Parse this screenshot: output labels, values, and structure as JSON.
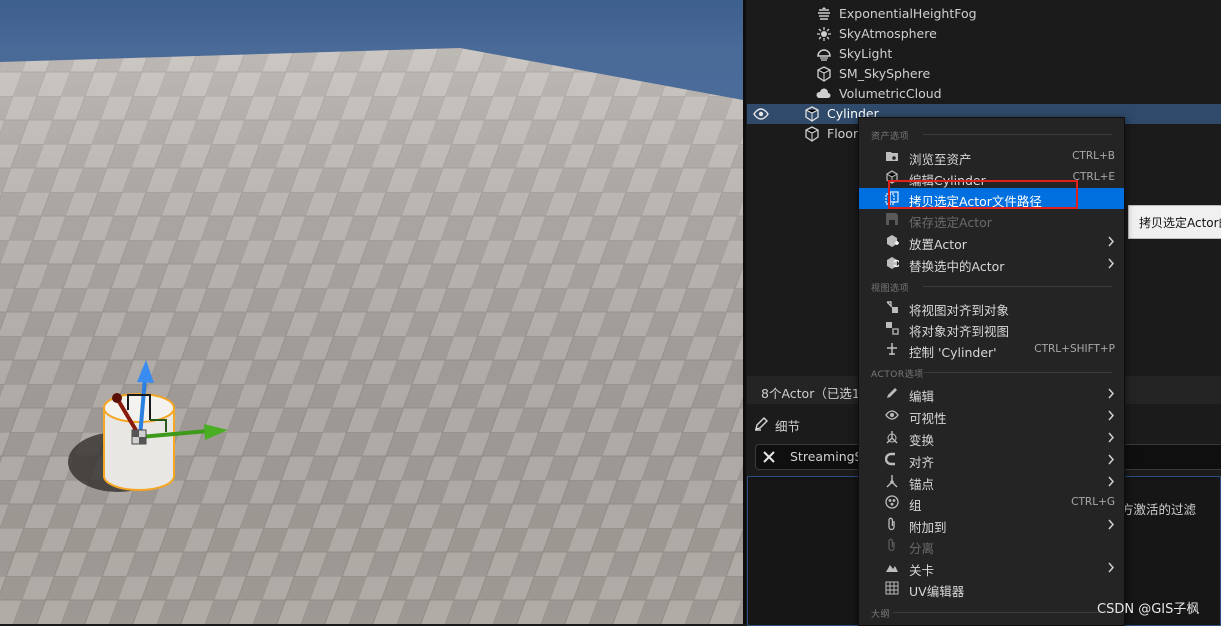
{
  "outliner": {
    "items": [
      {
        "label": "ExponentialHeightFog",
        "icon": "fog-icon"
      },
      {
        "label": "SkyAtmosphere",
        "icon": "sky-atmosphere-icon"
      },
      {
        "label": "SkyLight",
        "icon": "skylight-icon"
      },
      {
        "label": "SM_SkySphere",
        "icon": "static-mesh-icon"
      },
      {
        "label": "VolumetricCloud",
        "icon": "cloud-icon"
      },
      {
        "label": "Cylinder",
        "icon": "static-mesh-icon",
        "selected": true
      },
      {
        "label": "Floor",
        "icon": "static-mesh-icon"
      }
    ],
    "status": "8个Actor（已选1"
  },
  "details": {
    "title": "细节",
    "search_value": "StreamingSo",
    "hint_fragment": "更上方激活的过滤"
  },
  "tooltip": {
    "text": "拷贝选定Actor的"
  },
  "context_menu": {
    "sections": {
      "asset": "资产选项",
      "view": "视图选项",
      "actor": "ACTOR选项",
      "outline": "大纲"
    },
    "asset_items": [
      {
        "label": "浏览至资产",
        "shortcut": "CTRL+B",
        "icon": "browse-asset-icon"
      },
      {
        "label": "编辑Cylinder",
        "shortcut": "CTRL+E",
        "icon": "edit-mesh-icon"
      },
      {
        "label": "拷贝选定Actor文件路径",
        "icon": "copy-path-icon",
        "highlight": true
      },
      {
        "label": "保存选定Actor",
        "icon": "save-icon",
        "disabled": true
      },
      {
        "label": "放置Actor",
        "icon": "place-actor-icon",
        "submenu": true
      },
      {
        "label": "替换选中的Actor",
        "icon": "replace-actor-icon",
        "submenu": true
      }
    ],
    "view_items": [
      {
        "label": "将视图对齐到对象",
        "icon": "snap-view-icon"
      },
      {
        "label": "将对象对齐到视图",
        "icon": "snap-object-icon"
      },
      {
        "label": "控制 'Cylinder'",
        "shortcut": "CTRL+SHIFT+P",
        "icon": "pilot-icon"
      }
    ],
    "actor_items": [
      {
        "label": "编辑",
        "icon": "pencil-icon",
        "submenu": true
      },
      {
        "label": "可视性",
        "icon": "eye-icon",
        "submenu": true
      },
      {
        "label": "变换",
        "icon": "transform-icon",
        "submenu": true
      },
      {
        "label": "对齐",
        "icon": "magnet-icon",
        "submenu": true
      },
      {
        "label": "锚点",
        "icon": "pivot-icon",
        "submenu": true
      },
      {
        "label": "组",
        "shortcut": "CTRL+G",
        "icon": "group-icon"
      },
      {
        "label": "附加到",
        "icon": "paperclip-icon",
        "submenu": true
      },
      {
        "label": "分离",
        "icon": "detach-icon",
        "disabled": true
      },
      {
        "label": "关卡",
        "icon": "level-icon",
        "submenu": true
      },
      {
        "label": "UV编辑器",
        "icon": "uv-grid-icon"
      }
    ]
  },
  "watermark": "CSDN @GIS子枫",
  "colors": {
    "highlight": "#0070e0",
    "selected_row": "#2f4a6a",
    "annotation_box": "#e0201a"
  }
}
